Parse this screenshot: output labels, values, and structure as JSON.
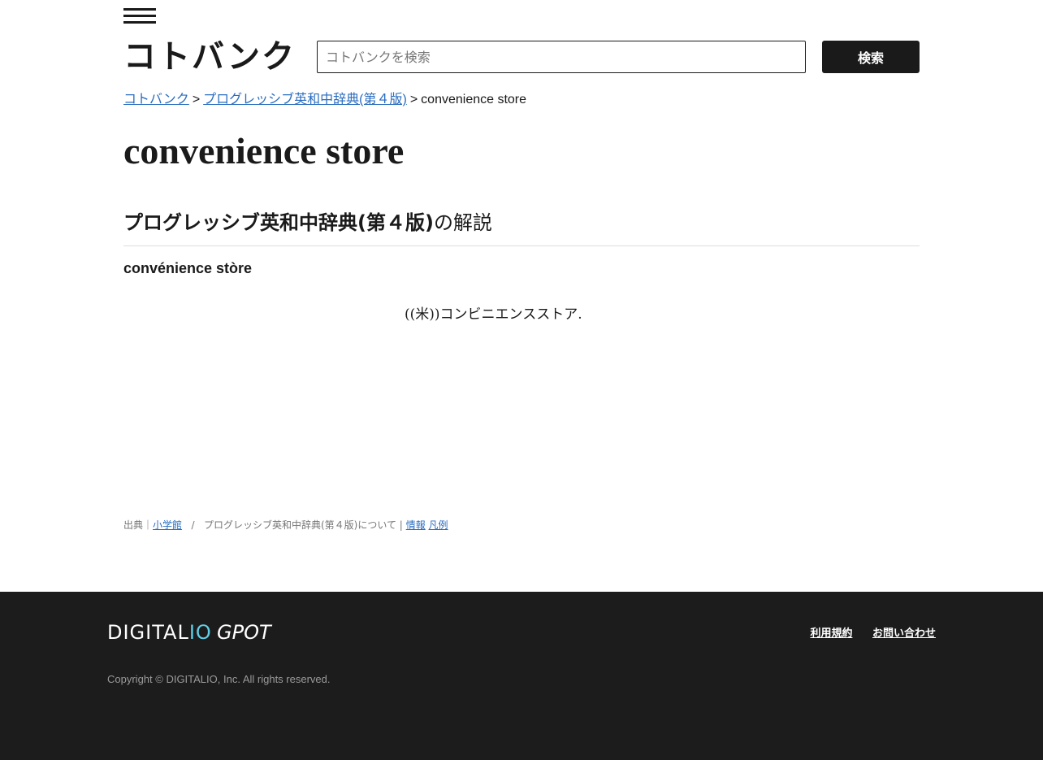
{
  "header": {
    "logo_text": "コトバンク",
    "search_placeholder": "コトバンクを検索",
    "search_button_label": "検索"
  },
  "breadcrumb": {
    "home": "コトバンク",
    "separator": ">",
    "dictionary": "プログレッシブ英和中辞典(第４版)",
    "current": "convenience store"
  },
  "entry": {
    "title": "convenience store",
    "section_dictionary": "プログレッシブ英和中辞典(第４版)",
    "section_suffix": "の解説",
    "headword": "convénience stòre",
    "definition": "((米))コンビニエンスストア."
  },
  "source": {
    "prefix": "出典｜",
    "publisher": "小学館",
    "divider": "/",
    "about": "プログレッシブ英和中辞典(第４版)について |",
    "info_link": "情報",
    "legend_link": "凡例"
  },
  "footer": {
    "brand_digitalio_main": "DIGITAL",
    "brand_digitalio_accent": "IO",
    "brand_gpot": "GPOT",
    "terms_link": "利用規約",
    "contact_link": "お問い合わせ",
    "copyright": "Copyright © DIGITALIO, Inc. All rights reserved."
  },
  "colors": {
    "link": "#2a6dbf",
    "footer_bg": "#1c1c1c",
    "button_bg": "#1a1a1a",
    "accent": "#5fd0e6"
  }
}
